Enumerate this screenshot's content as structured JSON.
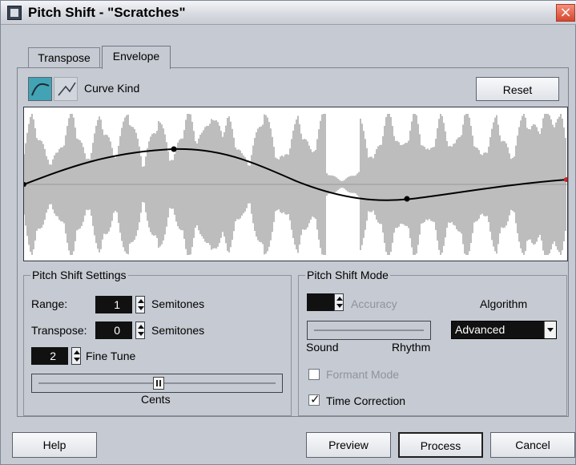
{
  "window": {
    "title": "Pitch Shift - \"Scratches\"",
    "close_icon": "close-icon"
  },
  "tabs": [
    {
      "label": "Transpose",
      "active": false
    },
    {
      "label": "Envelope",
      "active": true
    }
  ],
  "envelope": {
    "curve_kind_label": "Curve Kind",
    "reset_label": "Reset",
    "curve_icons": [
      "spline-curve-icon",
      "linear-curve-icon"
    ]
  },
  "pitch_shift_settings": {
    "title": "Pitch Shift Settings",
    "range_label": "Range:",
    "range_value": "1",
    "range_unit": "Semitones",
    "transpose_label": "Transpose:",
    "transpose_value": "0",
    "transpose_unit": "Semitones",
    "fine_tune_value": "2",
    "fine_tune_label": "Fine Tune",
    "cents_label": "Cents"
  },
  "pitch_shift_mode": {
    "title": "Pitch Shift Mode",
    "accuracy_label": "Accuracy",
    "algorithm_label": "Algorithm",
    "algorithm_value": "Advanced",
    "sound_label": "Sound",
    "rhythm_label": "Rhythm",
    "formant_mode_label": "Formant Mode",
    "time_correction_label": "Time Correction",
    "time_correction_checked": true
  },
  "bottom_buttons": {
    "help": "Help",
    "preview": "Preview",
    "process": "Process",
    "cancel": "Cancel"
  }
}
